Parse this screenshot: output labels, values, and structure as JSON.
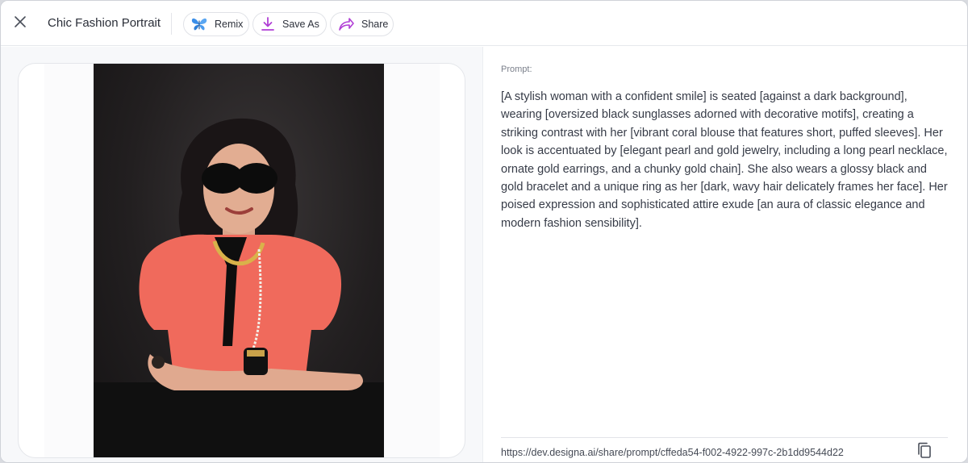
{
  "window": {
    "title": "Chic Fashion Portrait",
    "close_icon": "close-icon"
  },
  "toolbar": {
    "remix": {
      "label": "Remix",
      "icon": "butterfly-icon"
    },
    "save_as": {
      "label": "Save As",
      "icon": "download-icon"
    },
    "share": {
      "label": "Share",
      "icon": "share-arrow-icon"
    }
  },
  "image": {
    "alt": "Portrait of a woman in a coral blouse and oversized black sunglasses against a dark background"
  },
  "prompt": {
    "label": "Prompt:",
    "text": "[A stylish woman with a confident smile] is seated [against a dark background], wearing [oversized black sunglasses adorned with decorative motifs], creating a striking contrast with her [vibrant coral blouse that features short, puffed sleeves]. Her look is accentuated by [elegant pearl and gold jewelry, including a long pearl necklace, ornate gold earrings, and a chunky gold chain]. She also wears a glossy black and gold bracelet and a unique ring as her [dark, wavy hair delicately frames her face]. Her poised expression and sophisticated attire exude [an aura of classic elegance and modern fashion sensibility].",
    "share_url": "https://dev.designa.ai/share/prompt/cffeda54-f002-4922-997c-2b1dd9544d22",
    "copy_icon": "copy-icon"
  },
  "colors": {
    "accent_save": "#b13fd6",
    "accent_remix": "#3b8ee8",
    "blouse": "#f06a5c"
  }
}
